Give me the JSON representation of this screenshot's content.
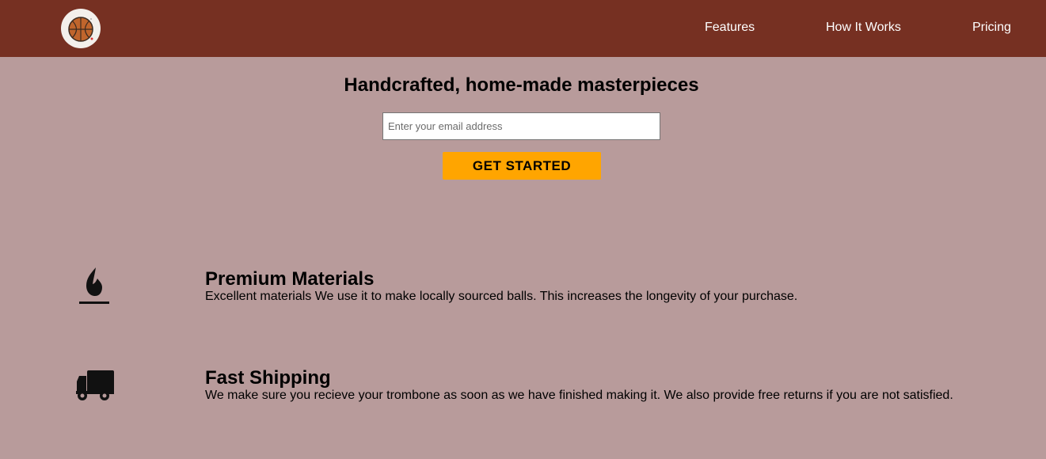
{
  "header": {
    "logo_icon": "basketball-icon",
    "nav": [
      {
        "label": "Features"
      },
      {
        "label": "How It Works"
      },
      {
        "label": "Pricing"
      }
    ]
  },
  "hero": {
    "title": "Handcrafted, home-made masterpieces",
    "email_placeholder": "Enter your email address",
    "cta_label": "GET STARTED"
  },
  "features": [
    {
      "icon": "fire-icon",
      "title": "Premium Materials",
      "description": "Excellent materials We use it to make locally sourced balls. This increases the longevity of your purchase."
    },
    {
      "icon": "truck-icon",
      "title": "Fast Shipping",
      "description": "We make sure you recieve your trombone as soon as we have finished making it. We also provide free returns if you are not satisfied."
    }
  ],
  "colors": {
    "header_bg": "#763022",
    "page_bg": "#b89b9b",
    "cta_bg": "#ffa500"
  }
}
